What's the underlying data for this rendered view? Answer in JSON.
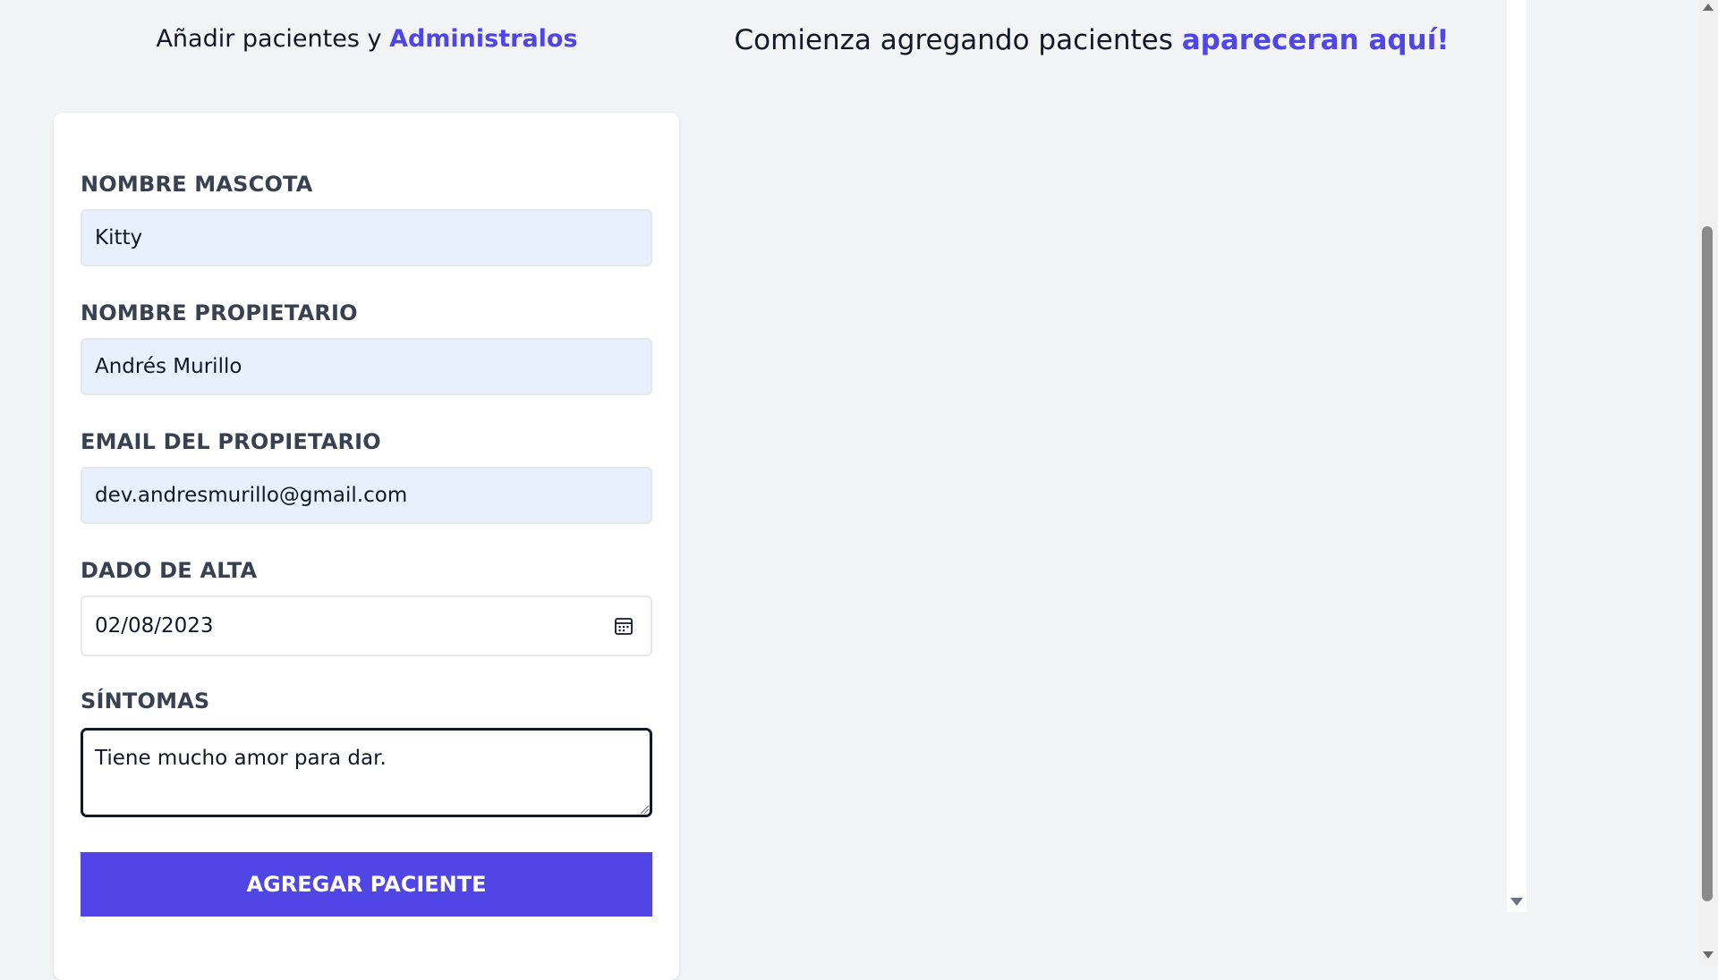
{
  "header_left": {
    "text": "Añadir pacientes y ",
    "accent": "Administralos"
  },
  "header_right": {
    "text": "Comienza agregando pacientes ",
    "accent": "apareceran aquí!"
  },
  "form": {
    "pet_name": {
      "label": "NOMBRE MASCOTA",
      "value": "Kitty"
    },
    "owner_name": {
      "label": "NOMBRE PROPIETARIO",
      "value": "Andrés Murillo"
    },
    "owner_email": {
      "label": "EMAIL DEL PROPIETARIO",
      "value": "dev.andresmurillo@gmail.com"
    },
    "discharge_date": {
      "label": "DADO DE ALTA",
      "value": "02/08/2023"
    },
    "symptoms": {
      "label": "SÍNTOMAS",
      "value": "Tiene mucho amor para dar."
    },
    "submit_label": "AGREGAR PACIENTE"
  },
  "colors": {
    "accent": "#4f46e5",
    "background": "#f3f4f6",
    "input_fill": "#e8f0fe"
  },
  "icons": {
    "date_picker": "calendar-icon"
  }
}
